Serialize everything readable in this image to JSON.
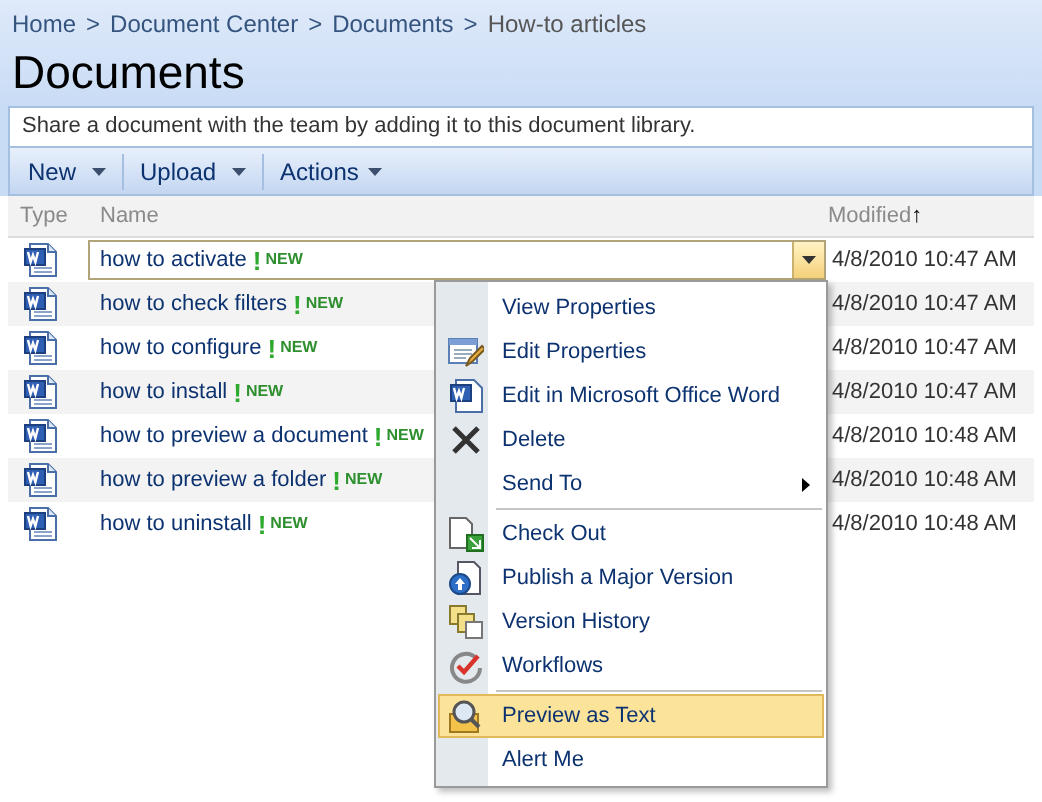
{
  "breadcrumb": [
    "Home",
    "Document Center",
    "Documents",
    "How-to articles"
  ],
  "breadcrumb_separator": ">",
  "title": "Documents",
  "description": "Share a document with the team by adding it to this document library.",
  "toolbar": [
    {
      "label": "New"
    },
    {
      "label": "Upload"
    },
    {
      "label": "Actions"
    }
  ],
  "columns": {
    "type": "Type",
    "name": "Name",
    "modified": "Modified",
    "sort_mark": "↑"
  },
  "rows": [
    {
      "name": "how to activate",
      "new_mark": "!",
      "new": "NEW",
      "modified": "4/8/2010 10:47 AM",
      "selected": true
    },
    {
      "name": "how to check filters",
      "new_mark": "!",
      "new": "NEW",
      "modified": "4/8/2010 10:47 AM",
      "selected": false
    },
    {
      "name": "how to configure",
      "new_mark": "!",
      "new": "NEW",
      "modified": "4/8/2010 10:47 AM",
      "selected": false
    },
    {
      "name": "how to install",
      "new_mark": "!",
      "new": "NEW",
      "modified": "4/8/2010 10:47 AM",
      "selected": false
    },
    {
      "name": "how to preview a document",
      "new_mark": "!",
      "new": "NEW",
      "modified": "4/8/2010 10:48 AM",
      "selected": false
    },
    {
      "name": "how to preview a folder",
      "new_mark": "!",
      "new": "NEW",
      "modified": "4/8/2010 10:48 AM",
      "selected": false
    },
    {
      "name": "how to uninstall",
      "new_mark": "!",
      "new": "NEW",
      "modified": "4/8/2010 10:48 AM",
      "selected": false
    }
  ],
  "context_menu": {
    "groups": [
      {
        "items": [
          {
            "label": "View Properties",
            "submenu": false,
            "selected": false
          },
          {
            "label": "Edit Properties",
            "submenu": false,
            "selected": false
          },
          {
            "label": "Edit in Microsoft Office Word",
            "submenu": false,
            "selected": false
          },
          {
            "label": "Delete",
            "submenu": false,
            "selected": false
          },
          {
            "label": "Send To",
            "submenu": true,
            "selected": false
          }
        ]
      },
      {
        "items": [
          {
            "label": "Check Out",
            "submenu": false,
            "selected": false
          },
          {
            "label": "Publish a Major Version",
            "submenu": false,
            "selected": false
          },
          {
            "label": "Version History",
            "submenu": false,
            "selected": false
          },
          {
            "label": "Workflows",
            "submenu": false,
            "selected": false
          }
        ]
      },
      {
        "items": [
          {
            "label": "Preview as Text",
            "submenu": false,
            "selected": true
          },
          {
            "label": "Alert Me",
            "submenu": false,
            "selected": false
          }
        ]
      }
    ]
  }
}
